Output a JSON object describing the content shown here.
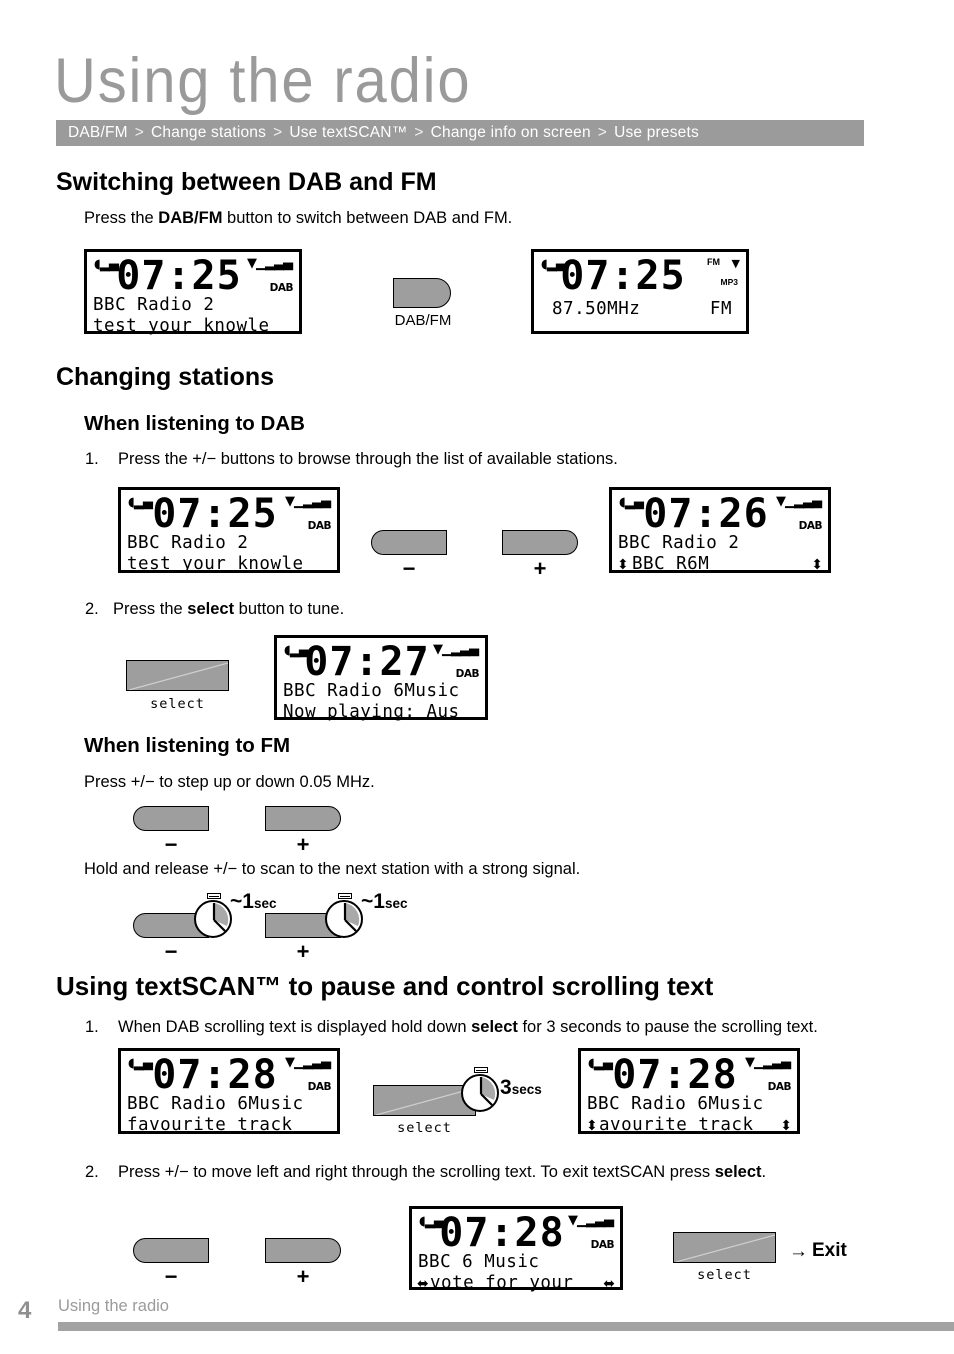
{
  "header": {
    "title": "Using the radio",
    "breadcrumb": [
      "DAB/FM",
      "Change stations",
      "Use textSCAN™",
      "Change info on screen",
      "Use presets"
    ],
    "separator": ">"
  },
  "colors": {
    "heading_grey": "#9a9a9a",
    "breadcrumb_bar": "#9b9b9b",
    "button_fill": "#9e9e9e",
    "footer_bar": "#a3a3a3"
  },
  "sections": {
    "switching": {
      "heading": "Switching between DAB and FM",
      "instruction_pre": "Press the ",
      "instruction_bold": "DAB/FM",
      "instruction_post": " button to switch between DAB and FM.",
      "dab_fm_button_label": "DAB/FM"
    },
    "changing": {
      "heading": "Changing stations",
      "sub_dab": "When listening to DAB",
      "step1_num": "1.",
      "step1_text": "Press the  +/−  buttons to browse through the list of available stations.",
      "step2_num": "2.",
      "step2_pre": "Press the ",
      "step2_bold": "select",
      "step2_post": " button to tune.",
      "sub_fm": "When listening to FM",
      "fm_step_text": "Press  +/−  to step up or down 0.05 MHz.",
      "fm_hold_text": "Hold and release  +/−  to scan to the next station with a strong signal.",
      "hold_time": "~1",
      "hold_time_unit": "sec"
    },
    "textscan": {
      "heading": "Using textSCAN™ to pause and control scrolling text",
      "step1_num": "1.",
      "step1_pre": "When DAB scrolling text is displayed hold down ",
      "step1_bold": "select",
      "step1_post": " for 3 seconds to pause the scrolling text.",
      "hold_time": "3",
      "hold_time_unit": "secs",
      "step2_num": "2.",
      "step2_pre": "Press  +/−  to move left and right through the scrolling text. To exit textSCAN press ",
      "step2_bold": "select",
      "step2_post": ".",
      "exit_arrow": "→",
      "exit_label": "Exit"
    }
  },
  "buttons": {
    "minus": "−",
    "plus": "+",
    "select": "select"
  },
  "displays": {
    "dab_main": {
      "signal_left": "signal-icon",
      "signal_right": "antenna-icon",
      "time": "07:25",
      "badge": "DAB",
      "line1": "BBC Radio 2",
      "line2": "test your knowle",
      "arrow_left": "",
      "arrow_right": ""
    },
    "fm_main": {
      "time": "07:25",
      "badge_fm": "FM",
      "badge_mp3": "MP3",
      "line1": "87.50MHz",
      "line1_right": "FM"
    },
    "dab_25": {
      "time": "07:25",
      "badge": "DAB",
      "line1": "BBC Radio 2",
      "line2": "test your knowle"
    },
    "dab_26": {
      "time": "07:26",
      "badge": "DAB",
      "line1": "BBC Radio 2",
      "line2": "BBC R6M",
      "arrow_left": "⬍",
      "arrow_right": "⬍"
    },
    "dab_27": {
      "time": "07:27",
      "badge": "DAB",
      "line1": "BBC Radio 6Music",
      "line2": "Now playing: Aus"
    },
    "dab_28a": {
      "time": "07:28",
      "badge": "DAB",
      "line1": "BBC Radio 6Music",
      "line2": "favourite track"
    },
    "dab_28b": {
      "time": "07:28",
      "badge": "DAB",
      "line1": "BBC Radio 6Music",
      "line2": "avourite track",
      "arrow_left": "⬍",
      "arrow_right": "⬍"
    },
    "dab_28c": {
      "time": "07:28",
      "badge": "DAB",
      "line1": "BBC 6 Music",
      "line2": "vote for your",
      "arrow_left": "⬌",
      "arrow_right": "⬌"
    }
  },
  "footer": {
    "page_number": "4",
    "text": "Using the radio"
  }
}
